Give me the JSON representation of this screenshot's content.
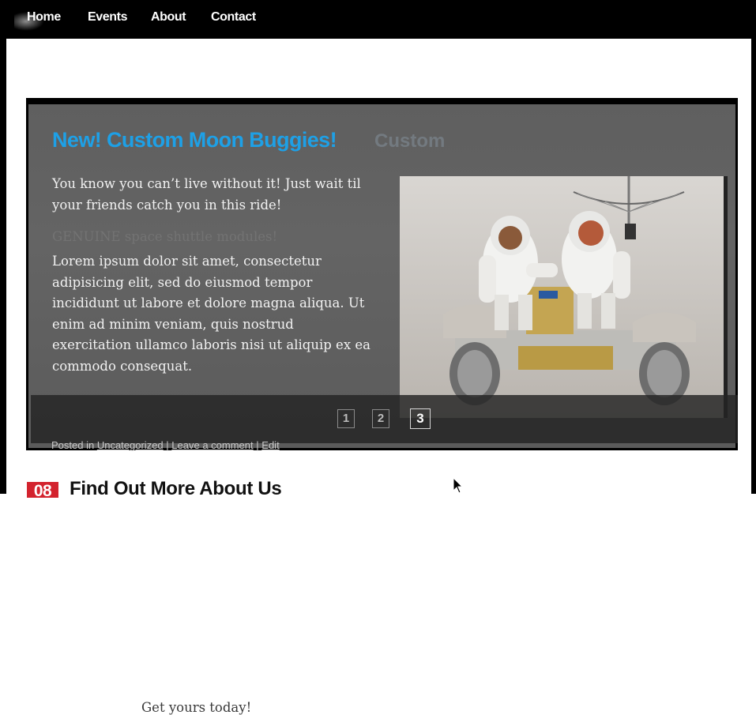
{
  "nav": {
    "items": [
      {
        "label": "Home"
      },
      {
        "label": "Events"
      },
      {
        "label": "About"
      },
      {
        "label": "Contact"
      }
    ]
  },
  "slide": {
    "title": "New! Custom Moon Buggies!",
    "ghost_title": "Custom",
    "intro": "You know you can’t live without it! Just wait til your friends catch you in this ride!",
    "ghost_line": "GENUINE space shuttle modules!",
    "lorem": "Lorem ipsum dolor sit amet, consectetur adipisicing elit, sed do eiusmod tempor incididunt ut labore et dolore magna aliqua. Ut enim ad minim veniam, quis nostrud exercitation ullamco laboris nisi ut aliquip ex ea commodo consequat.",
    "ghost_cta": "Get yours today!",
    "image_alt": "moon-buggy-astronauts-photo"
  },
  "pager": {
    "pages": [
      "1",
      "2",
      "3"
    ],
    "active": "3"
  },
  "post_meta": {
    "prefix": "Posted in",
    "category": "Uncategorized",
    "separator": "|",
    "comment_link": "Leave a comment",
    "edit_link": "Edit"
  },
  "next_post": {
    "date_badge": "08",
    "heading": "Find Out More About Us"
  },
  "colors": {
    "title_blue": "#1ea0e6",
    "badge_red": "#d3232e",
    "nav_bg": "#000000"
  }
}
